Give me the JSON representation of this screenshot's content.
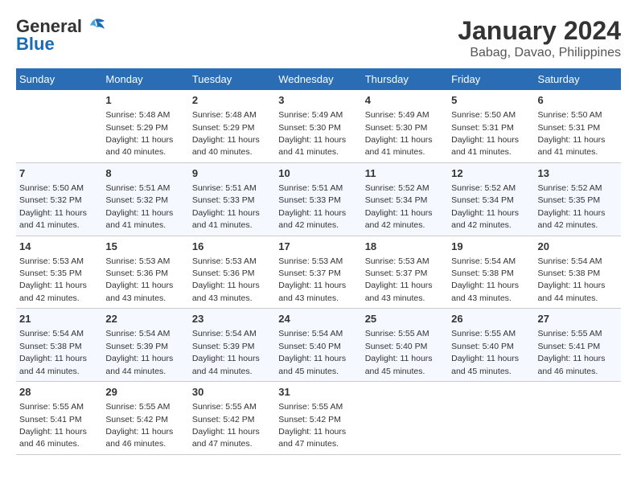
{
  "header": {
    "logo_general": "General",
    "logo_blue": "Blue",
    "title": "January 2024",
    "subtitle": "Babag, Davao, Philippines"
  },
  "days_of_week": [
    "Sunday",
    "Monday",
    "Tuesday",
    "Wednesday",
    "Thursday",
    "Friday",
    "Saturday"
  ],
  "weeks": [
    [
      {
        "day": "",
        "sunrise": "",
        "sunset": "",
        "daylight": ""
      },
      {
        "day": "1",
        "sunrise": "Sunrise: 5:48 AM",
        "sunset": "Sunset: 5:29 PM",
        "daylight": "Daylight: 11 hours and 40 minutes."
      },
      {
        "day": "2",
        "sunrise": "Sunrise: 5:48 AM",
        "sunset": "Sunset: 5:29 PM",
        "daylight": "Daylight: 11 hours and 40 minutes."
      },
      {
        "day": "3",
        "sunrise": "Sunrise: 5:49 AM",
        "sunset": "Sunset: 5:30 PM",
        "daylight": "Daylight: 11 hours and 41 minutes."
      },
      {
        "day": "4",
        "sunrise": "Sunrise: 5:49 AM",
        "sunset": "Sunset: 5:30 PM",
        "daylight": "Daylight: 11 hours and 41 minutes."
      },
      {
        "day": "5",
        "sunrise": "Sunrise: 5:50 AM",
        "sunset": "Sunset: 5:31 PM",
        "daylight": "Daylight: 11 hours and 41 minutes."
      },
      {
        "day": "6",
        "sunrise": "Sunrise: 5:50 AM",
        "sunset": "Sunset: 5:31 PM",
        "daylight": "Daylight: 11 hours and 41 minutes."
      }
    ],
    [
      {
        "day": "7",
        "sunrise": "Sunrise: 5:50 AM",
        "sunset": "Sunset: 5:32 PM",
        "daylight": "Daylight: 11 hours and 41 minutes."
      },
      {
        "day": "8",
        "sunrise": "Sunrise: 5:51 AM",
        "sunset": "Sunset: 5:32 PM",
        "daylight": "Daylight: 11 hours and 41 minutes."
      },
      {
        "day": "9",
        "sunrise": "Sunrise: 5:51 AM",
        "sunset": "Sunset: 5:33 PM",
        "daylight": "Daylight: 11 hours and 41 minutes."
      },
      {
        "day": "10",
        "sunrise": "Sunrise: 5:51 AM",
        "sunset": "Sunset: 5:33 PM",
        "daylight": "Daylight: 11 hours and 42 minutes."
      },
      {
        "day": "11",
        "sunrise": "Sunrise: 5:52 AM",
        "sunset": "Sunset: 5:34 PM",
        "daylight": "Daylight: 11 hours and 42 minutes."
      },
      {
        "day": "12",
        "sunrise": "Sunrise: 5:52 AM",
        "sunset": "Sunset: 5:34 PM",
        "daylight": "Daylight: 11 hours and 42 minutes."
      },
      {
        "day": "13",
        "sunrise": "Sunrise: 5:52 AM",
        "sunset": "Sunset: 5:35 PM",
        "daylight": "Daylight: 11 hours and 42 minutes."
      }
    ],
    [
      {
        "day": "14",
        "sunrise": "Sunrise: 5:53 AM",
        "sunset": "Sunset: 5:35 PM",
        "daylight": "Daylight: 11 hours and 42 minutes."
      },
      {
        "day": "15",
        "sunrise": "Sunrise: 5:53 AM",
        "sunset": "Sunset: 5:36 PM",
        "daylight": "Daylight: 11 hours and 43 minutes."
      },
      {
        "day": "16",
        "sunrise": "Sunrise: 5:53 AM",
        "sunset": "Sunset: 5:36 PM",
        "daylight": "Daylight: 11 hours and 43 minutes."
      },
      {
        "day": "17",
        "sunrise": "Sunrise: 5:53 AM",
        "sunset": "Sunset: 5:37 PM",
        "daylight": "Daylight: 11 hours and 43 minutes."
      },
      {
        "day": "18",
        "sunrise": "Sunrise: 5:53 AM",
        "sunset": "Sunset: 5:37 PM",
        "daylight": "Daylight: 11 hours and 43 minutes."
      },
      {
        "day": "19",
        "sunrise": "Sunrise: 5:54 AM",
        "sunset": "Sunset: 5:38 PM",
        "daylight": "Daylight: 11 hours and 43 minutes."
      },
      {
        "day": "20",
        "sunrise": "Sunrise: 5:54 AM",
        "sunset": "Sunset: 5:38 PM",
        "daylight": "Daylight: 11 hours and 44 minutes."
      }
    ],
    [
      {
        "day": "21",
        "sunrise": "Sunrise: 5:54 AM",
        "sunset": "Sunset: 5:38 PM",
        "daylight": "Daylight: 11 hours and 44 minutes."
      },
      {
        "day": "22",
        "sunrise": "Sunrise: 5:54 AM",
        "sunset": "Sunset: 5:39 PM",
        "daylight": "Daylight: 11 hours and 44 minutes."
      },
      {
        "day": "23",
        "sunrise": "Sunrise: 5:54 AM",
        "sunset": "Sunset: 5:39 PM",
        "daylight": "Daylight: 11 hours and 44 minutes."
      },
      {
        "day": "24",
        "sunrise": "Sunrise: 5:54 AM",
        "sunset": "Sunset: 5:40 PM",
        "daylight": "Daylight: 11 hours and 45 minutes."
      },
      {
        "day": "25",
        "sunrise": "Sunrise: 5:55 AM",
        "sunset": "Sunset: 5:40 PM",
        "daylight": "Daylight: 11 hours and 45 minutes."
      },
      {
        "day": "26",
        "sunrise": "Sunrise: 5:55 AM",
        "sunset": "Sunset: 5:40 PM",
        "daylight": "Daylight: 11 hours and 45 minutes."
      },
      {
        "day": "27",
        "sunrise": "Sunrise: 5:55 AM",
        "sunset": "Sunset: 5:41 PM",
        "daylight": "Daylight: 11 hours and 46 minutes."
      }
    ],
    [
      {
        "day": "28",
        "sunrise": "Sunrise: 5:55 AM",
        "sunset": "Sunset: 5:41 PM",
        "daylight": "Daylight: 11 hours and 46 minutes."
      },
      {
        "day": "29",
        "sunrise": "Sunrise: 5:55 AM",
        "sunset": "Sunset: 5:42 PM",
        "daylight": "Daylight: 11 hours and 46 minutes."
      },
      {
        "day": "30",
        "sunrise": "Sunrise: 5:55 AM",
        "sunset": "Sunset: 5:42 PM",
        "daylight": "Daylight: 11 hours and 47 minutes."
      },
      {
        "day": "31",
        "sunrise": "Sunrise: 5:55 AM",
        "sunset": "Sunset: 5:42 PM",
        "daylight": "Daylight: 11 hours and 47 minutes."
      },
      {
        "day": "",
        "sunrise": "",
        "sunset": "",
        "daylight": ""
      },
      {
        "day": "",
        "sunrise": "",
        "sunset": "",
        "daylight": ""
      },
      {
        "day": "",
        "sunrise": "",
        "sunset": "",
        "daylight": ""
      }
    ]
  ]
}
